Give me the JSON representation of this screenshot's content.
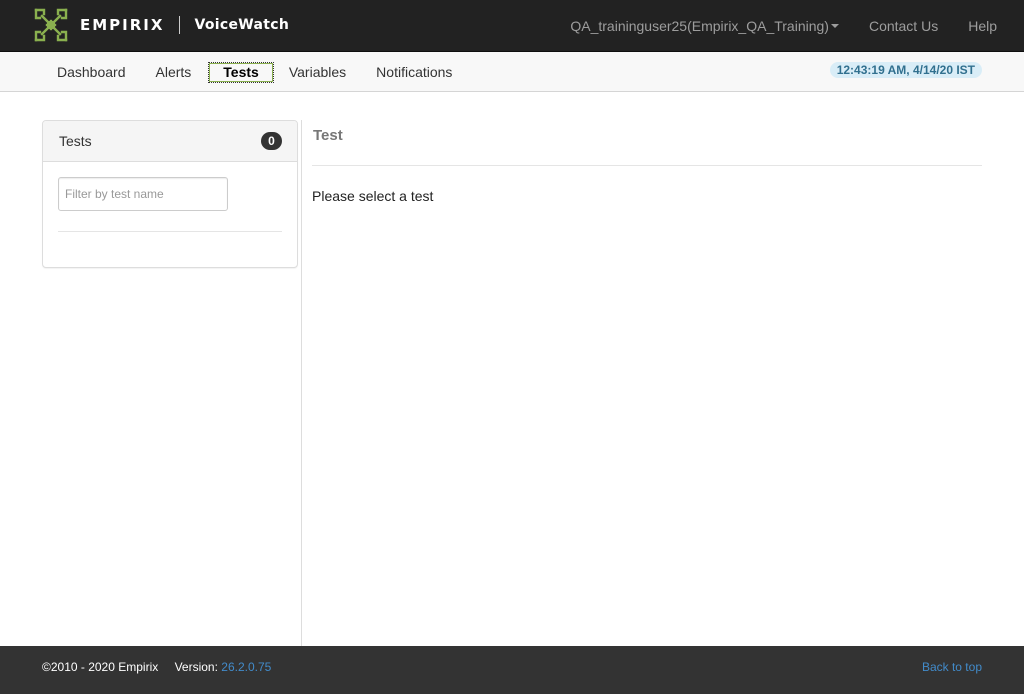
{
  "header": {
    "brand_name": "EMPIRIX",
    "product_name": "VoiceWatch",
    "user_menu_label": "QA_traininguser25(Empirix_QA_Training)",
    "contact_label": "Contact Us",
    "help_label": "Help",
    "logo_icon": "empirix-logo-icon",
    "logo_color": "#8ab04f"
  },
  "subnav": {
    "tabs": [
      {
        "label": "Dashboard"
      },
      {
        "label": "Alerts"
      },
      {
        "label": "Tests",
        "active": true
      },
      {
        "label": "Variables"
      },
      {
        "label": "Notifications"
      }
    ],
    "timestamp": "12:43:19 AM, 4/14/20 IST"
  },
  "tests_panel": {
    "title": "Tests",
    "count": "0",
    "filter_placeholder": "Filter by test name",
    "filter_value": ""
  },
  "main": {
    "title": "Test",
    "message": "Please select a test"
  },
  "footer": {
    "copyright": "©2010 - 2020 Empirix",
    "version_label": "Version:",
    "version_value": "26.2.0.75",
    "back_to_top": "Back to top"
  }
}
